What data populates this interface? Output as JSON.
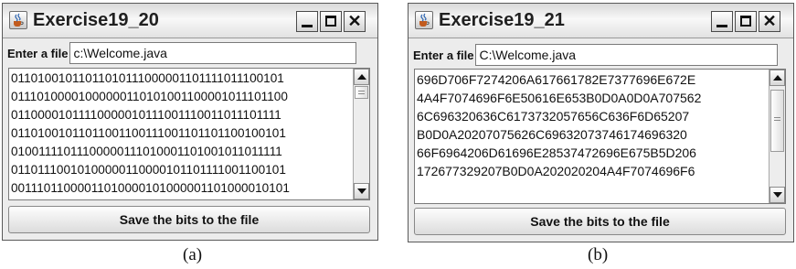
{
  "windows": [
    {
      "title": "Exercise19_20",
      "file_label": "Enter a file",
      "file_value": "c:\\Welcome.java",
      "content_lines": [
        "01101001011011010111000001101111011100101",
        "01110100001000000110101001100001011101100",
        "01100001011110000010111001110011011101111",
        "01101001011011001100111001101101100100101",
        "01001111011100000111010001101001011011111",
        "01101110010100000110000101101111001100101",
        "00111011000011010000101000001101000010101"
      ],
      "button_label": "Save the bits to the file",
      "caption": "(a)"
    },
    {
      "title": "Exercise19_21",
      "file_label": "Enter a file",
      "file_value": "C:\\Welcome.java",
      "content_lines": [
        "696D706F7274206A617661782E7377696E672E",
        "4A4F7074696F6E50616E653B0D0A0D0A707562",
        "6C696320636C6173732057656C636F6D65207",
        "B0D0A20207075626C69632073746174696320",
        "66F6964206D61696E28537472696E675B5D206",
        "172677329207B0D0A202020204A4F7074696F6"
      ],
      "button_label": "Save the bits to the file",
      "caption": "(b)"
    }
  ]
}
